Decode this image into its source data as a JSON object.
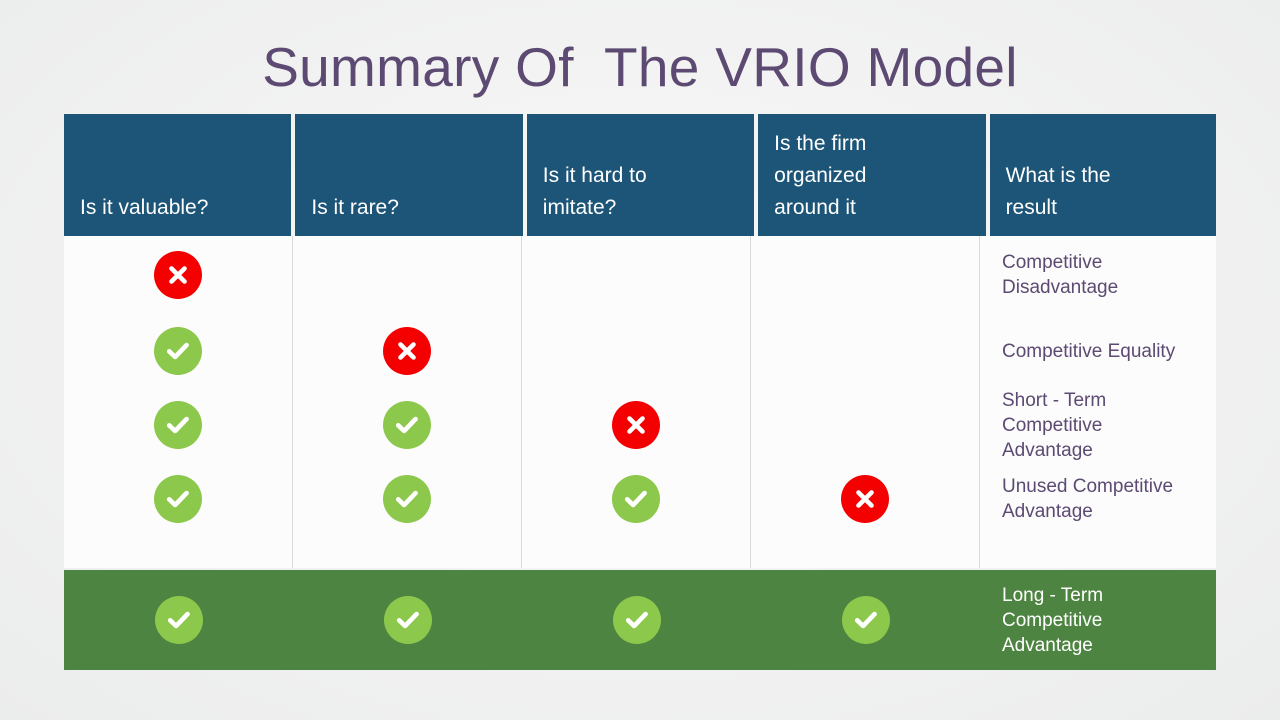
{
  "slide": {
    "title": "Summary Of  The VRIO Model",
    "title_color": "#5c4a72",
    "background_color": "#f2f3f3"
  },
  "colors": {
    "header_blue": "#1c5578",
    "highlight_green": "#4d8441",
    "check_green": "#8cc84b",
    "cross_red": "#f40000",
    "body_white": "#fcfcfc",
    "text_purple": "#5c4a72",
    "divider_gray": "#d8d8d8"
  },
  "table": {
    "headers": [
      {
        "label": "Is it valuable?"
      },
      {
        "label": "Is it rare?"
      },
      {
        "label": "Is it hard to\nimitate?"
      },
      {
        "label": "Is the firm\norganized\naround it"
      },
      {
        "label": "What is the\nresult"
      }
    ],
    "rows": [
      {
        "valuable": "cross",
        "rare": "none",
        "imitate": "none",
        "organized": "none",
        "result": "Competitive\nDisadvantage",
        "highlighted": false
      },
      {
        "valuable": "check",
        "rare": "cross",
        "imitate": "none",
        "organized": "none",
        "result": "Competitive Equality",
        "highlighted": false
      },
      {
        "valuable": "check",
        "rare": "check",
        "imitate": "cross",
        "organized": "none",
        "result": "Short - Term\nCompetitive\nAdvantage",
        "highlighted": false
      },
      {
        "valuable": "check",
        "rare": "check",
        "imitate": "check",
        "organized": "cross",
        "result": "Unused Competitive\nAdvantage",
        "highlighted": false
      },
      {
        "valuable": "check",
        "rare": "check",
        "imitate": "check",
        "organized": "check",
        "result": "Long - Term\nCompetitive\nAdvantage",
        "highlighted": true
      }
    ],
    "icon_names": {
      "check": "check-circle-icon",
      "cross": "cross-circle-icon"
    }
  }
}
